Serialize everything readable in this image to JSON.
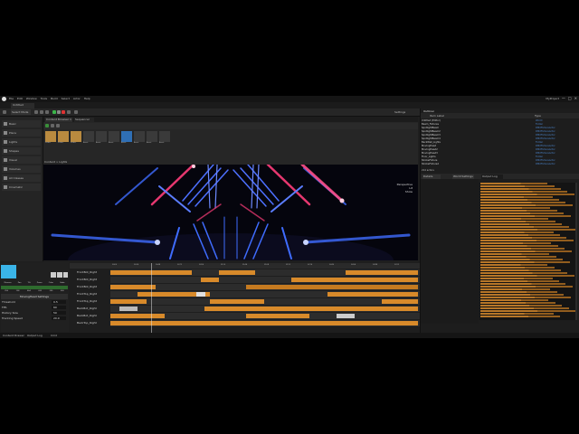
{
  "window": {
    "menu": [
      "File",
      "Edit",
      "Window",
      "Tools",
      "Build",
      "Select",
      "Actor",
      "Help"
    ],
    "project": "MyProject",
    "controls": [
      "—",
      "□",
      "×"
    ]
  },
  "tabs": {
    "main": "Untitled",
    "level": "Untitled"
  },
  "toolbar": {
    "mode": "Select Mode",
    "settings": "Settings"
  },
  "left_panel": {
    "items": [
      "Basic",
      "Place",
      "Lights",
      "Shapes",
      "Visual",
      "Volumes",
      "All Classes",
      "Cinematic"
    ]
  },
  "content_browser": {
    "tabs": [
      "Content Browser 1",
      "Sequencer"
    ],
    "assets": [
      "Folder",
      "Folder",
      "Folder",
      "Asset",
      "Asset",
      "Asset",
      "Asset",
      "Asset",
      "Asset",
      "Asset",
      "Asset",
      "Asset"
    ],
    "path": "Content > Lights"
  },
  "viewport": {
    "overlay": "Perspective\nLit\nShow"
  },
  "outliner": {
    "title": "Outliner",
    "columns": [
      "Item Label",
      "Type"
    ],
    "rows": [
      {
        "name": "Untitled (Editor)",
        "type": "World"
      },
      {
        "name": "  Beam_Fixtures",
        "type": "Folder"
      },
      {
        "name": "    SpotlightBeam",
        "type": "DMXFixtureActor"
      },
      {
        "name": "    SpotlightBeam2",
        "type": "DMXFixtureActor"
      },
      {
        "name": "    SpotlightBeam3",
        "type": "DMXFixtureActor"
      },
      {
        "name": "    SpotlightBeam4",
        "type": "DMXFixtureActor"
      },
      {
        "name": "  BackWall_Lights",
        "type": "Folder"
      },
      {
        "name": "    MovingHead",
        "type": "DMXFixtureActor"
      },
      {
        "name": "    MovingHead2",
        "type": "DMXFixtureActor"
      },
      {
        "name": "    MovingHead3",
        "type": "DMXFixtureActor"
      },
      {
        "name": "  Floor_Lights",
        "type": "Folder"
      },
      {
        "name": "    StrobeFixture",
        "type": "DMXFixtureActor"
      },
      {
        "name": "    StrobeFixture2",
        "type": "DMXFixtureActor"
      }
    ],
    "count": "214 actors"
  },
  "details": {
    "tabs": [
      "Details",
      "World Settings",
      "Output Log"
    ]
  },
  "dmx": {
    "channels": [
      "Dimmer",
      "Pan",
      "Tilt",
      "Zoom",
      "Color",
      "Gobo"
    ],
    "values": [
      "255",
      "128",
      "064",
      "032",
      "255",
      "000"
    ],
    "title": "MovingHead Settings",
    "settings": [
      {
        "k": "Threshold",
        "v": "0.5"
      },
      {
        "k": "FPS",
        "v": "60"
      },
      {
        "k": "History Size",
        "v": "50"
      },
      {
        "k": "Tracking Speed",
        "v": "20.0"
      }
    ]
  },
  "timeline": {
    "ticks": [
      "0000",
      "0024",
      "0048",
      "0072",
      "0096",
      "0120",
      "0144",
      "0168",
      "0192",
      "0216",
      "0240",
      "0264",
      "0288",
      "0312"
    ],
    "tracks": [
      "FrontBot_Right",
      "FrontBot_Right",
      "FrontBot_Right",
      "FrontTop_Right",
      "FrontTop_Right",
      "BackBot_Right",
      "BackBot_Right",
      "BackTop_Right"
    ]
  },
  "status": {
    "left": "Content Drawer",
    "middle": "Output Log",
    "right": "Cmd"
  },
  "colors": {
    "accent": "#3ab4e8",
    "clip": "#d88a2a",
    "beam_blue": "#3f6cff",
    "beam_pink": "#ff3d7a"
  }
}
